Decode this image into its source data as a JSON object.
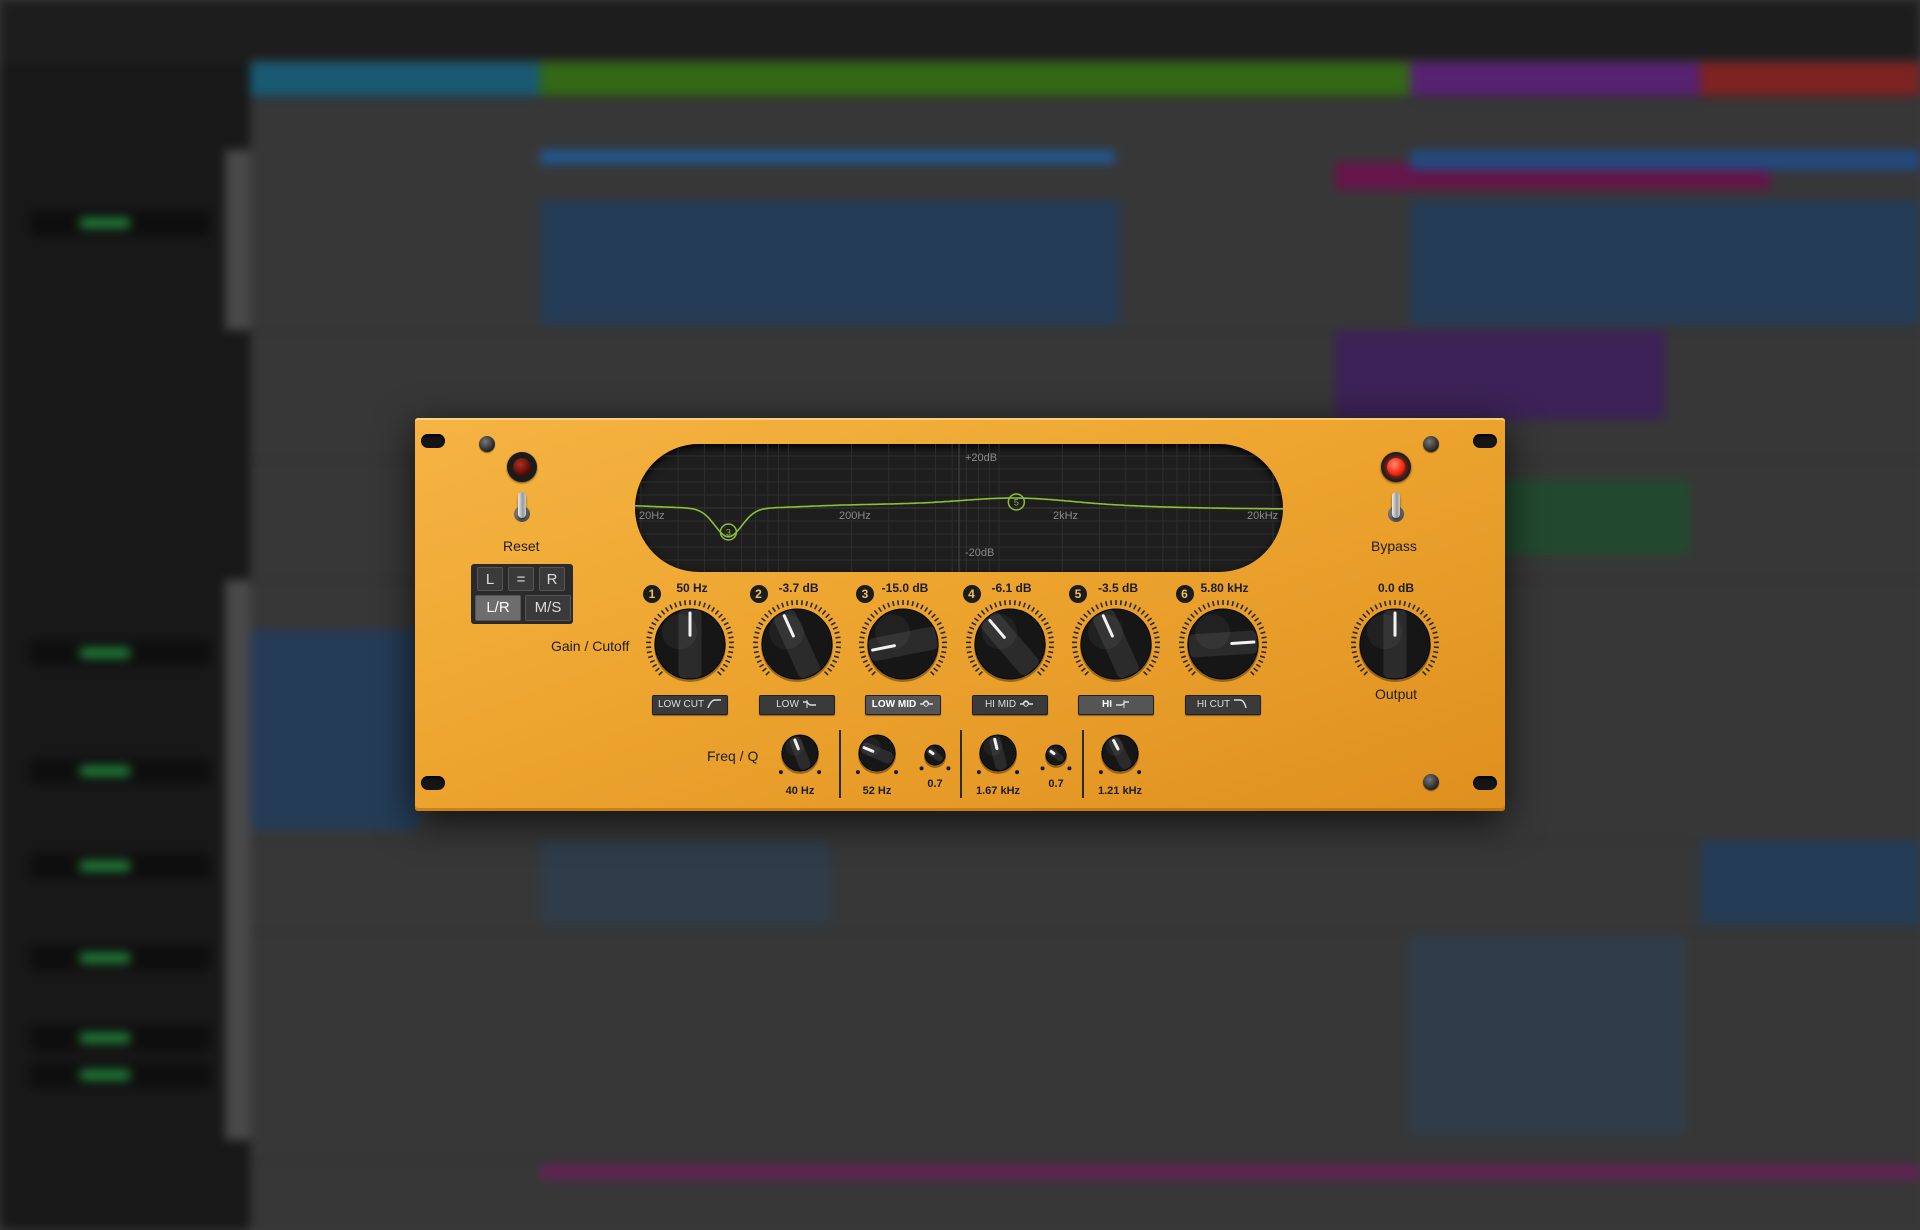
{
  "plugin": {
    "reset_label": "Reset",
    "bypass_label": "Bypass",
    "gain_cutoff_label": "Gain / Cutoff",
    "freq_q_label": "Freq / Q",
    "output_label": "Output",
    "output_value": "0.0 dB",
    "bypass_led_on": true,
    "reset_led_on": false,
    "accent_color": "#eda52f",
    "curve_color": "#8bbf3a",
    "mode_buttons": {
      "left": "L",
      "link": "=",
      "right": "R",
      "lr": "L/R",
      "ms": "M/S",
      "active": "lr"
    },
    "display": {
      "top_label": "+20dB",
      "bottom_label": "-20dB",
      "freq_labels": [
        "20Hz",
        "200Hz",
        "2kHz",
        "20kHz"
      ],
      "nodes": [
        {
          "band": "3",
          "freq_hz": 52,
          "gain_db": -15.0
        },
        {
          "band": "5",
          "freq_hz": 1210,
          "gain_db": -3.5
        }
      ]
    },
    "bands": [
      {
        "number": "1",
        "value": "50 Hz",
        "type_label": "LOW CUT",
        "type_icon": "lowcut-icon",
        "active": false,
        "knob_level": 0.5
      },
      {
        "number": "2",
        "value": "-3.7 dB",
        "type_label": "LOW",
        "type_icon": "lowshelf-icon",
        "active": false,
        "knob_level": 0.41
      },
      {
        "number": "3",
        "value": "-15.0 dB",
        "type_label": "LOW MID",
        "type_icon": "bell-icon",
        "active": true,
        "knob_level": 0.125
      },
      {
        "number": "4",
        "value": "-6.1 dB",
        "type_label": "HI MID",
        "type_icon": "bell-icon",
        "active": false,
        "knob_level": 0.35
      },
      {
        "number": "5",
        "value": "-3.5 dB",
        "type_label": "HI",
        "type_icon": "highshelf-icon",
        "active": true,
        "knob_level": 0.41
      },
      {
        "number": "6",
        "value": "5.80 kHz",
        "type_label": "HI CUT",
        "type_icon": "highcut-icon",
        "active": false,
        "knob_level": 0.82
      }
    ],
    "freq_q": [
      {
        "freq": "40 Hz",
        "freq_level": 0.42,
        "q": "",
        "q_level": null
      },
      {
        "freq": "52 Hz",
        "freq_level": 0.25,
        "q": "0.7",
        "q_level": 0.3
      },
      {
        "freq": "1.67 kHz",
        "freq_level": 0.45,
        "q": "0.7",
        "q_level": 0.3
      },
      {
        "freq": "1.21 kHz",
        "freq_level": 0.4,
        "q": "",
        "q_level": null
      }
    ],
    "output_level": 0.5
  }
}
